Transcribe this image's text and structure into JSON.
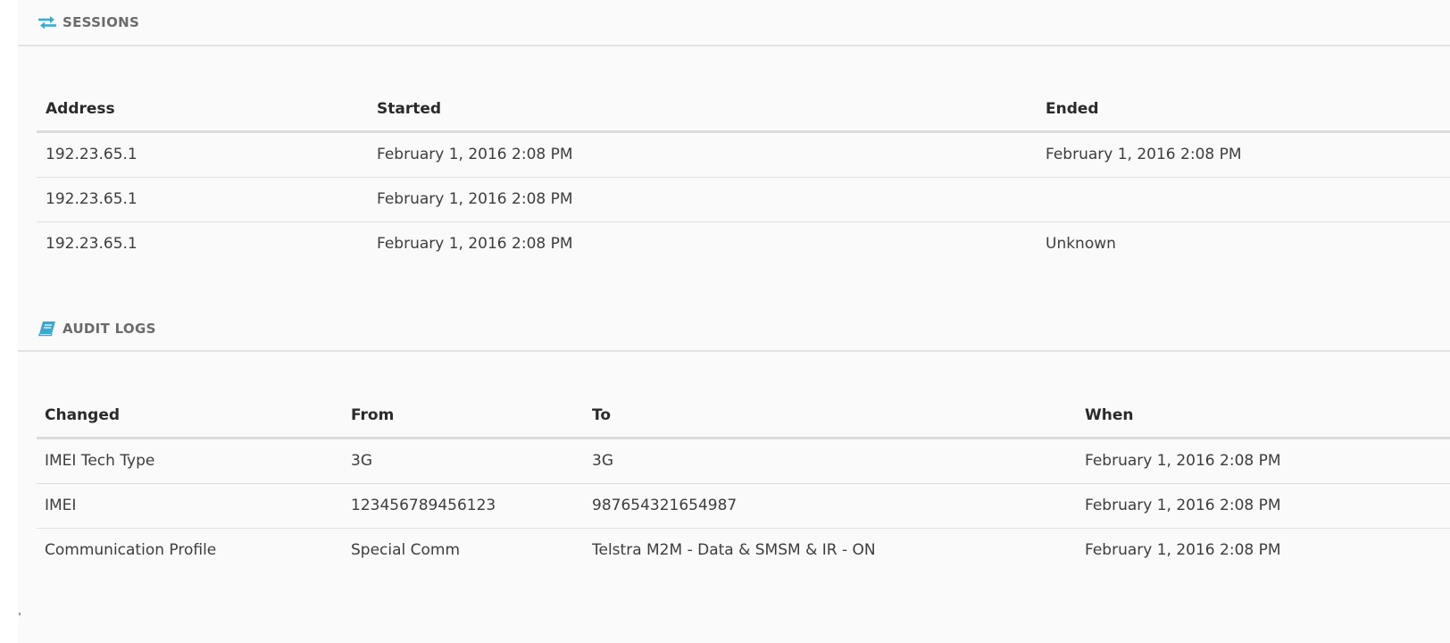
{
  "colors": {
    "accent": "#3aa9cf",
    "background": "#fafafa",
    "divider": "#e3e3e3"
  },
  "sessions": {
    "title": "SESSIONS",
    "icon": "swap-arrows-icon",
    "columns": [
      "Address",
      "Started",
      "Ended"
    ],
    "rows": [
      [
        "192.23.65.1",
        "February 1, 2016 2:08 PM",
        "February 1, 2016 2:08 PM"
      ],
      [
        "192.23.65.1",
        "February 1, 2016 2:08 PM",
        ""
      ],
      [
        "192.23.65.1",
        "February 1, 2016 2:08 PM",
        "Unknown"
      ]
    ]
  },
  "audit_logs": {
    "title": "AUDIT LOGS",
    "icon": "book-icon",
    "columns": [
      "Changed",
      "From",
      "To",
      "When"
    ],
    "rows": [
      [
        "IMEI Tech Type",
        "3G",
        "3G",
        "February 1, 2016 2:08 PM"
      ],
      [
        "IMEI",
        "123456789456123",
        "987654321654987",
        "February 1, 2016 2:08 PM"
      ],
      [
        "Communication Profile",
        "Special Comm",
        "Telstra M2M - Data & SMSM & IR - ON",
        "February 1, 2016 2:08 PM"
      ]
    ]
  }
}
